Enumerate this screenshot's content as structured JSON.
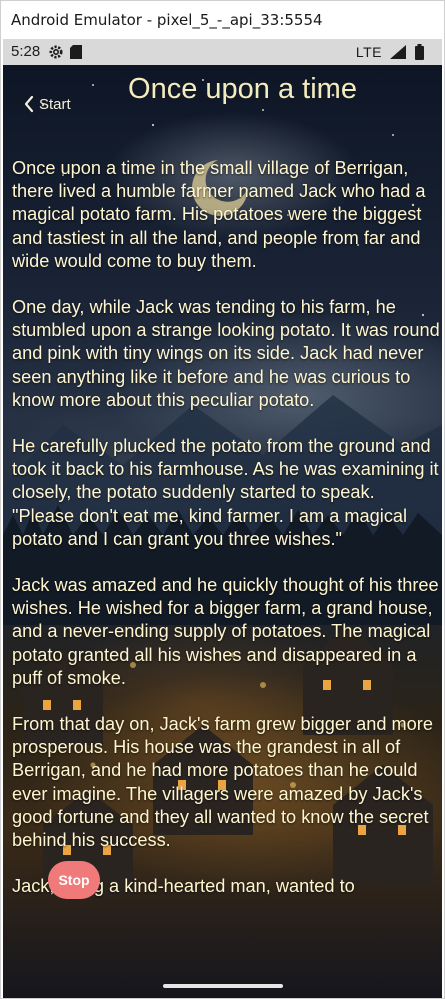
{
  "window": {
    "title": "Android Emulator - pixel_5_-_api_33:5554"
  },
  "status_bar": {
    "time": "5:28",
    "network": "LTE"
  },
  "header": {
    "back_label": "Start",
    "title": "Once upon a time"
  },
  "story": {
    "paragraphs": [
      "Once upon a time in the small village of Berrigan, there lived a humble farmer named Jack who had a magical potato farm. His potatoes were the biggest and tastiest in all the land, and people from far and wide would come to buy them.",
      "One day, while Jack was tending to his farm, he stumbled upon a strange looking potato. It was round and pink with tiny wings on its side. Jack had never seen anything like it before and he was curious to know more about this peculiar potato.",
      "He carefully plucked the potato from the ground and took it back to his farmhouse. As he was examining it closely, the potato suddenly started to speak. \"Please don't eat me, kind farmer. I am a magical potato and I can grant you three wishes.\"",
      "Jack was amazed and he quickly thought of his three wishes. He wished for a bigger farm, a grand house, and a never-ending supply of potatoes. The magical potato granted all his wishes and disappeared in a puff of smoke.",
      "From that day on, Jack's farm grew bigger and more prosperous. His house was the grandest in all of Berrigan, and he had more potatoes than he could ever imagine. The villagers were amazed by Jack's good fortune and they all wanted to know the secret behind his success.",
      "Jack, being a kind-hearted man, wanted to"
    ]
  },
  "stop_button": {
    "label": "Stop"
  },
  "colors": {
    "text": "#fff6cf",
    "title": "#f5ecbe",
    "stop_button": "#f07a7a",
    "status_bar": "#d9d9d9"
  },
  "icons": {
    "status": [
      "gear-icon",
      "sd-card-icon",
      "signal-icon",
      "battery-icon"
    ],
    "back": "chevron-left-icon"
  }
}
